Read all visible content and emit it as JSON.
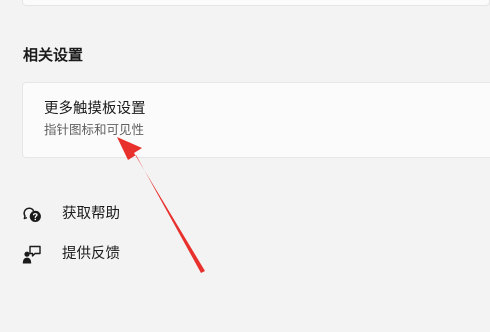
{
  "related_settings": {
    "heading": "相关设置",
    "card": {
      "title": "更多触摸板设置",
      "subtitle": "指针图标和可见性"
    }
  },
  "links": {
    "help": {
      "label": "获取帮助",
      "icon": "get-help-icon"
    },
    "feedback": {
      "label": "提供反馈",
      "icon": "give-feedback-icon"
    }
  },
  "annotation": {
    "arrow_color": "#e8302c",
    "target": "更多触摸板设置"
  }
}
